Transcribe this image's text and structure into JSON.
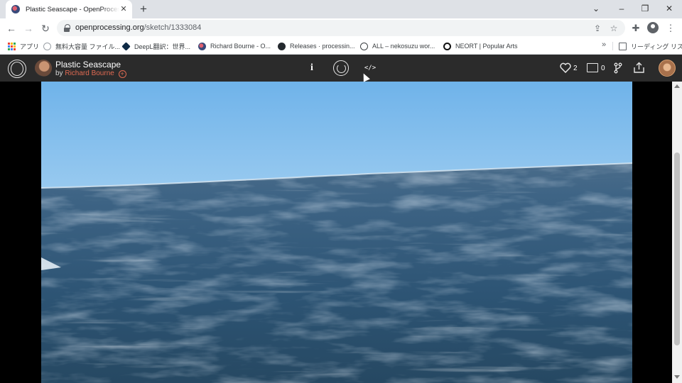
{
  "browser": {
    "tab": {
      "title": "Plastic Seascape - OpenProcessing",
      "close_glyph": "✕"
    },
    "newtab_glyph": "+",
    "window_controls": {
      "dropdown": "⌄",
      "minimize": "–",
      "restore": "❐",
      "close": "✕"
    },
    "nav": {
      "back": "←",
      "forward": "→",
      "reload": "↻"
    },
    "address": {
      "host": "openprocessing.org",
      "path": "/sketch/1333084"
    },
    "toolbar_icons": {
      "share": "⇪",
      "star": "☆",
      "extensions": "✚",
      "menu": "⋮"
    },
    "bookmarks": [
      {
        "label": "アプリ",
        "icon": "apps-grid-icon"
      },
      {
        "label": "無料大容量 ファイル...",
        "icon": "globe-icon"
      },
      {
        "label": "DeepL翻訳：世界...",
        "icon": "deepl-icon"
      },
      {
        "label": "Richard Bourne - O...",
        "icon": "openprocessing-icon"
      },
      {
        "label": "Releases · processin...",
        "icon": "github-icon"
      },
      {
        "label": "ALL – nekosuzu wor...",
        "icon": "nekosuzu-icon"
      },
      {
        "label": "NEORT | Popular Arts",
        "icon": "neort-icon"
      }
    ],
    "bookmarks_more": "»",
    "reading_list": "リーディング リスト"
  },
  "sketch": {
    "title": "Plastic Seascape",
    "by": "by",
    "author": "Richard Bourne",
    "follow_glyph": "+",
    "info_glyph": "i",
    "code_glyph": "</>",
    "likes": "2",
    "comments": "0"
  },
  "colors": {
    "accent": "#e06a52",
    "header_bg": "#2b2b2b",
    "sky_top": "#6fb3ea",
    "sky_horizon": "#e8f3fb",
    "sea_deep": "#2a4864"
  }
}
